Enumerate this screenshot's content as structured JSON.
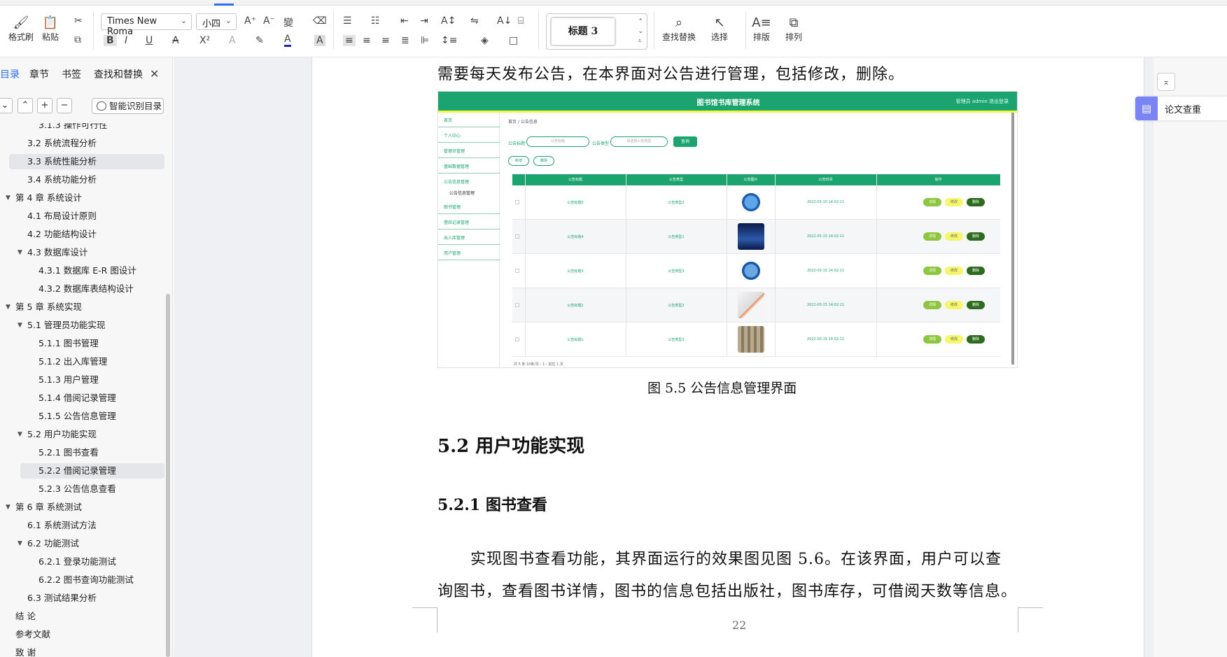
{
  "ribbon": {
    "format_painter": "格式刷",
    "paste": "粘贴",
    "font_name": "Times New Roma",
    "font_size": "小四",
    "style_current": "标题 3",
    "find_replace": "查找替换",
    "select": "选择",
    "layout": "排版",
    "arrange": "排列"
  },
  "sidebar": {
    "tabs": [
      "目录",
      "章节",
      "书签",
      "查找和替换"
    ],
    "smart_toc": "智能识别目录",
    "toc": [
      {
        "label": "3.1.3  操作可行性",
        "level": 3
      },
      {
        "label": "3.2  系统流程分析",
        "level": 2
      },
      {
        "label": "3.3  系统性能分析",
        "level": 2
      },
      {
        "label": "3.4  系统功能分析",
        "level": 2
      },
      {
        "label": "第 4 章  系统设计",
        "level": 1
      },
      {
        "label": "4.1  布局设计原则",
        "level": 2
      },
      {
        "label": "4.2  功能结构设计",
        "level": 2
      },
      {
        "label": "4.3  数据库设计",
        "level": 2
      },
      {
        "label": "4.3.1  数据库 E-R 图设计",
        "level": 3
      },
      {
        "label": "4.3.2  数据库表结构设计",
        "level": 3
      },
      {
        "label": "第 5 章  系统实现",
        "level": 1
      },
      {
        "label": "5.1  管理员功能实现",
        "level": 2
      },
      {
        "label": "5.1.1  图书管理",
        "level": 3
      },
      {
        "label": "5.1.2  出入库管理",
        "level": 3
      },
      {
        "label": "5.1.3  用户管理",
        "level": 3
      },
      {
        "label": "5.1.4  借阅记录管理",
        "level": 3
      },
      {
        "label": "5.1.5  公告信息管理",
        "level": 3
      },
      {
        "label": "5.2  用户功能实现",
        "level": 2
      },
      {
        "label": "5.2.1  图书查看",
        "level": 3
      },
      {
        "label": "5.2.2  借阅记录管理",
        "level": 3
      },
      {
        "label": "5.2.3  公告信息查看",
        "level": 3
      },
      {
        "label": "第 6 章  系统测试",
        "level": 1
      },
      {
        "label": "6.1  系统测试方法",
        "level": 2
      },
      {
        "label": "6.2  功能测试",
        "level": 2
      },
      {
        "label": "6.2.1  登录功能测试",
        "level": 3
      },
      {
        "label": "6.2.2  图书查询功能测试",
        "level": 3
      },
      {
        "label": "6.3  测试结果分析",
        "level": 2
      },
      {
        "label": "结   论",
        "level": 1
      },
      {
        "label": "参考文献",
        "level": 1
      },
      {
        "label": "致   谢",
        "level": 1
      }
    ]
  },
  "document": {
    "line_top": "需要每天发布公告，在本界面对公告进行管理，包括修改，删除。",
    "figure_caption": "图 5.5  公告信息管理界面",
    "heading_2": "5.2  用户功能实现",
    "heading_3": "5.2.1  图书查看",
    "para_line1": "实现图书查看功能，其界面运行的效果图见图 5.6。在该界面，用户可以查",
    "para_line2": "询图书，查看图书详情，图书的信息包括出版社，图书库存，可借阅天数等信息。",
    "page_number": "22"
  },
  "screenshot": {
    "title": "图书馆书库管理系统",
    "user": "管理员 admin    退出登录",
    "menu": [
      "首页",
      "个人中心",
      "管理员管理",
      "基础数据管理",
      "公告信息管理",
      "公告信息管理",
      "图书管理",
      "借阅记录管理",
      "出入库管理",
      "用户管理"
    ],
    "crumb": "首页  /  公告信息",
    "search_title_label": "公告标题",
    "search_title_ph": "公告标题",
    "search_type_label": "公告类型",
    "search_type_ph": "请选择公告类型",
    "search_btn": "查询",
    "add_btn": "新增",
    "del_btn": "删除",
    "columns": [
      "公告标题",
      "公告类型",
      "公告图片",
      "公告时间",
      "操作"
    ],
    "rows": [
      {
        "title": "公告标题5",
        "type": "公告类型2",
        "time": "2022-03-15 14:02:11"
      },
      {
        "title": "公告标题4",
        "type": "公告类型1",
        "time": "2022-03-15 14:02:11"
      },
      {
        "title": "公告标题3",
        "type": "公告类型3",
        "time": "2022-03-15 14:02:11"
      },
      {
        "title": "公告标题2",
        "type": "公告类型2",
        "time": "2022-03-15 14:02:11"
      },
      {
        "title": "公告标题1",
        "type": "公告类型3",
        "time": "2022-03-15 14:02:11"
      }
    ],
    "ops": [
      "详情",
      "修改",
      "删除"
    ],
    "pager": "共 5 条    10条/页    ‹   1   ›    前往   1   页"
  },
  "right_panel": {
    "paper_check": "论文查重"
  }
}
